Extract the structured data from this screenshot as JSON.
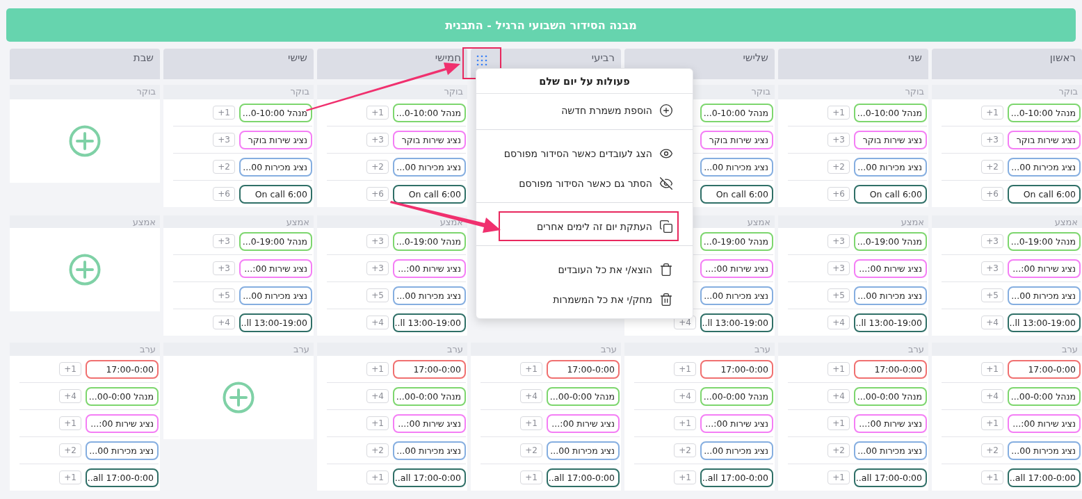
{
  "title": "מבנה הסידור השבועי הרגיל - התבנית",
  "days": [
    {
      "name": "ראשון",
      "sections": [
        {
          "kind": "shifts",
          "label": "בוקר",
          "shifts": [
            {
              "text": "מנהל 0-10:00...",
              "color": "#7dd66e",
              "count": "+1"
            },
            {
              "text": "נציג שירות בוקר",
              "color": "#f47ef5",
              "count": "+3"
            },
            {
              "text": "נציג מכירות 00...",
              "color": "#85aee0",
              "count": "+2"
            },
            {
              "text": "On call 6:00",
              "color": "#2f6f67",
              "count": "+6"
            }
          ]
        },
        {
          "kind": "shifts",
          "label": "אמצע",
          "shifts": [
            {
              "text": "מנהל 0-19:00...",
              "color": "#7dd66e",
              "count": "+3"
            },
            {
              "text": "נציג שירות 00:...",
              "color": "#f47ef5",
              "count": "+3"
            },
            {
              "text": "נציג מכירות 00...",
              "color": "#85aee0",
              "count": "+5"
            },
            {
              "text": "13:00-19:00 ll...",
              "color": "#2f6f67",
              "count": "+4"
            }
          ]
        },
        {
          "kind": "shifts",
          "label": "ערב",
          "shifts": [
            {
              "text": "17:00-0:00",
              "color": "#f07070",
              "count": "+1"
            },
            {
              "text": "מנהל 00-0:00...",
              "color": "#7dd66e",
              "count": "+4"
            },
            {
              "text": "נציג שירות 00:...",
              "color": "#f47ef5",
              "count": "+1"
            },
            {
              "text": "נציג מכירות 00...",
              "color": "#85aee0",
              "count": "+2"
            },
            {
              "text": "17:00-0:00 all...",
              "color": "#2f6f67",
              "count": "+1"
            }
          ]
        }
      ]
    },
    {
      "name": "שני",
      "sections": [
        {
          "kind": "shifts",
          "label": "בוקר",
          "shifts": [
            {
              "text": "מנהל 0-10:00...",
              "color": "#7dd66e",
              "count": "+1"
            },
            {
              "text": "נציג שירות בוקר",
              "color": "#f47ef5",
              "count": "+3"
            },
            {
              "text": "נציג מכירות 00...",
              "color": "#85aee0",
              "count": "+2"
            },
            {
              "text": "On call 6:00",
              "color": "#2f6f67",
              "count": "+6"
            }
          ]
        },
        {
          "kind": "shifts",
          "label": "אמצע",
          "shifts": [
            {
              "text": "מנהל 0-19:00...",
              "color": "#7dd66e",
              "count": "+3"
            },
            {
              "text": "נציג שירות 00:...",
              "color": "#f47ef5",
              "count": "+3"
            },
            {
              "text": "נציג מכירות 00...",
              "color": "#85aee0",
              "count": "+5"
            },
            {
              "text": "13:00-19:00 ll...",
              "color": "#2f6f67",
              "count": "+4"
            }
          ]
        },
        {
          "kind": "shifts",
          "label": "ערב",
          "shifts": [
            {
              "text": "17:00-0:00",
              "color": "#f07070",
              "count": "+1"
            },
            {
              "text": "מנהל 00-0:00...",
              "color": "#7dd66e",
              "count": "+4"
            },
            {
              "text": "נציג שירות 00:...",
              "color": "#f47ef5",
              "count": "+1"
            },
            {
              "text": "נציג מכירות 00...",
              "color": "#85aee0",
              "count": "+2"
            },
            {
              "text": "17:00-0:00 all...",
              "color": "#2f6f67",
              "count": "+1"
            }
          ]
        }
      ]
    },
    {
      "name": "שלישי",
      "sections": [
        {
          "kind": "shifts",
          "label": "בוקר",
          "shifts": [
            {
              "text": "מנהל 0-10:00...",
              "color": "#7dd66e"
            },
            {
              "text": "נציג שירות בוקר",
              "color": "#f47ef5"
            },
            {
              "text": "נציג מכירות 00...",
              "color": "#85aee0"
            },
            {
              "text": "On call 6:00",
              "color": "#2f6f67"
            }
          ]
        },
        {
          "kind": "shifts",
          "label": "אמצע",
          "shifts": [
            {
              "text": "מנהל 0-19:00...",
              "color": "#7dd66e"
            },
            {
              "text": "נציג שירות 00:...",
              "color": "#f47ef5"
            },
            {
              "text": "נציג מכירות 00...",
              "color": "#85aee0"
            },
            {
              "text": "13:00-19:00 ll...",
              "color": "#2f6f67",
              "count": "+4"
            }
          ]
        },
        {
          "kind": "shifts",
          "label": "ערב",
          "shifts": [
            {
              "text": "17:00-0:00",
              "color": "#f07070",
              "count": "+1"
            },
            {
              "text": "מנהל 00-0:00...",
              "color": "#7dd66e",
              "count": "+4"
            },
            {
              "text": "נציג שירות 00:...",
              "color": "#f47ef5",
              "count": "+1"
            },
            {
              "text": "נציג מכירות 00...",
              "color": "#85aee0",
              "count": "+2"
            },
            {
              "text": "17:00-0:00 all...",
              "color": "#2f6f67",
              "count": "+1"
            }
          ]
        }
      ]
    },
    {
      "name": "רביעי",
      "grip_highlighted": true,
      "menu": {
        "title": "פעולות על יום שלם",
        "groups": [
          [
            {
              "label": "הוספת משמרת חדשה",
              "highlighted": false
            }
          ],
          [
            {
              "label": "הצג לעובדים כאשר הסידור מפורסם",
              "highlighted": false
            },
            {
              "label": "הסתר גם כאשר הסידור מפורסם",
              "highlighted": false
            }
          ],
          [
            {
              "label": "העתקת יום זה לימים אחרים",
              "highlighted": true
            }
          ],
          [
            {
              "label": "הוצא/י את כל העובדים",
              "highlighted": false
            },
            {
              "label": "מחק/י את כל המשמרות",
              "highlighted": false
            }
          ]
        ]
      },
      "sections": [
        {
          "kind": "covered"
        },
        {
          "kind": "covered"
        },
        {
          "kind": "shifts",
          "label": "ערב",
          "shifts": [
            {
              "text": "17:00-0:00",
              "color": "#f07070",
              "count": "+1"
            },
            {
              "text": "מנהל 00-0:00...",
              "color": "#7dd66e",
              "count": "+4"
            },
            {
              "text": "נציג שירות 00:...",
              "color": "#f47ef5",
              "count": "+1"
            },
            {
              "text": "נציג מכירות 00...",
              "color": "#85aee0",
              "count": "+2"
            },
            {
              "text": "17:00-0:00 all...",
              "color": "#2f6f67",
              "count": "+1"
            }
          ]
        }
      ]
    },
    {
      "name": "חמישי",
      "sections": [
        {
          "kind": "shifts",
          "label": "בוקר",
          "shifts": [
            {
              "text": "מנהל 0-10:00...",
              "color": "#7dd66e",
              "count": "+1"
            },
            {
              "text": "נציג שירות בוקר",
              "color": "#f47ef5",
              "count": "+3"
            },
            {
              "text": "נציג מכירות 00...",
              "color": "#85aee0",
              "count": "+2"
            },
            {
              "text": "On call 6:00",
              "color": "#2f6f67",
              "count": "+6"
            }
          ]
        },
        {
          "kind": "shifts",
          "label": "אמצע",
          "shifts": [
            {
              "text": "מנהל 0-19:00...",
              "color": "#7dd66e",
              "count": "+3"
            },
            {
              "text": "נציג שירות 00:...",
              "color": "#f47ef5",
              "count": "+3"
            },
            {
              "text": "נציג מכירות 00...",
              "color": "#85aee0",
              "count": "+5"
            },
            {
              "text": "13:00-19:00 ll...",
              "color": "#2f6f67",
              "count": "+4"
            }
          ]
        },
        {
          "kind": "shifts",
          "label": "ערב",
          "shifts": [
            {
              "text": "17:00-0:00",
              "color": "#f07070",
              "count": "+1"
            },
            {
              "text": "מנהל 00-0:00...",
              "color": "#7dd66e",
              "count": "+4"
            },
            {
              "text": "נציג שירות 00:...",
              "color": "#f47ef5",
              "count": "+1"
            },
            {
              "text": "נציג מכירות 00...",
              "color": "#85aee0",
              "count": "+2"
            },
            {
              "text": "17:00-0:00 all...",
              "color": "#2f6f67",
              "count": "+1"
            }
          ]
        }
      ]
    },
    {
      "name": "שישי",
      "sections": [
        {
          "kind": "shifts",
          "label": "בוקר",
          "shifts": [
            {
              "text": "מנהל 0-10:00...",
              "color": "#7dd66e",
              "count": "+1"
            },
            {
              "text": "נציג שירות בוקר",
              "color": "#f47ef5",
              "count": "+3"
            },
            {
              "text": "נציג מכירות 00...",
              "color": "#85aee0",
              "count": "+2"
            },
            {
              "text": "On call 6:00",
              "color": "#2f6f67",
              "count": "+6"
            }
          ]
        },
        {
          "kind": "shifts",
          "label": "אמצע",
          "shifts": [
            {
              "text": "מנהל 0-19:00...",
              "color": "#7dd66e",
              "count": "+3"
            },
            {
              "text": "נציג שירות 00:...",
              "color": "#f47ef5",
              "count": "+3"
            },
            {
              "text": "נציג מכירות 00...",
              "color": "#85aee0",
              "count": "+5"
            },
            {
              "text": "13:00-19:00 ll...",
              "color": "#2f6f67",
              "count": "+4"
            }
          ]
        },
        {
          "kind": "empty",
          "label": "ערב"
        }
      ]
    },
    {
      "name": "שבת",
      "sections": [
        {
          "kind": "empty",
          "label": "בוקר"
        },
        {
          "kind": "empty",
          "label": "אמצע"
        },
        {
          "kind": "shifts",
          "label": "ערב",
          "shifts": [
            {
              "text": "17:00-0:00",
              "color": "#f07070",
              "count": "+1"
            },
            {
              "text": "מנהל 00-0:00...",
              "color": "#7dd66e",
              "count": "+4"
            },
            {
              "text": "נציג שירות 00:...",
              "color": "#f47ef5",
              "count": "+1"
            },
            {
              "text": "נציג מכירות 00...",
              "color": "#85aee0",
              "count": "+2"
            },
            {
              "text": "17:00-0:00 all...",
              "color": "#2f6f67",
              "count": "+1"
            }
          ]
        }
      ]
    }
  ]
}
